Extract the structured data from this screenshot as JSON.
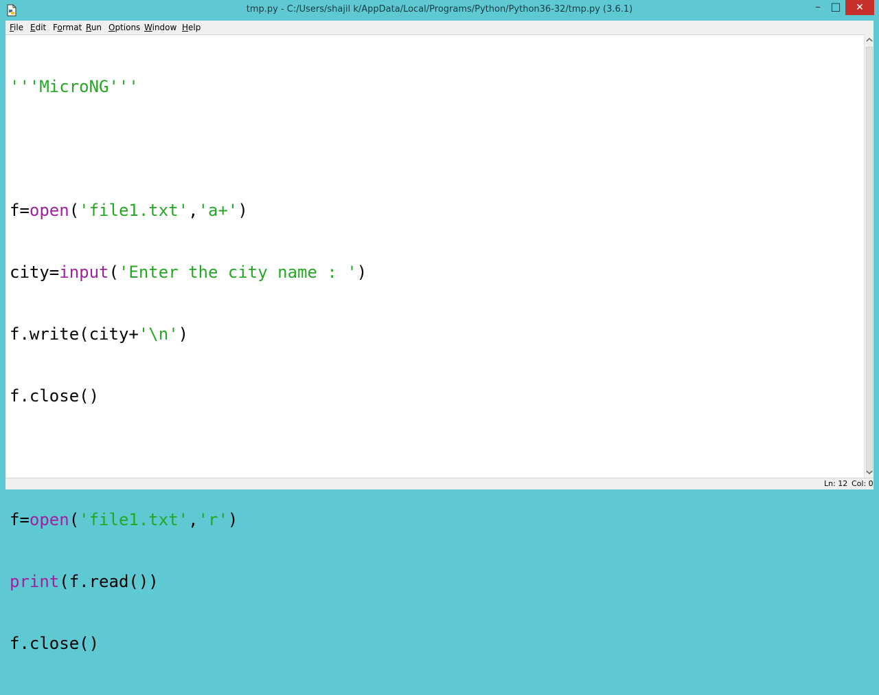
{
  "window": {
    "title": "tmp.py - C:/Users/shajil k/AppData/Local/Programs/Python/Python36-32/tmp.py (3.6.1)",
    "minimize_glyph": "–",
    "maximize_glyph": "□",
    "close_glyph": "✕"
  },
  "menu": {
    "file": {
      "key": "F",
      "rest": "ile"
    },
    "edit": {
      "key": "E",
      "rest": "dit"
    },
    "format": {
      "pre": "F",
      "key": "o",
      "rest": "rmat"
    },
    "run": {
      "key": "R",
      "rest": "un"
    },
    "options": {
      "key": "O",
      "rest": "ptions"
    },
    "window": {
      "key": "W",
      "rest": "indow"
    },
    "help": {
      "key": "H",
      "rest": "elp"
    }
  },
  "code": {
    "line1": {
      "docstring": "'''MicroNG'''"
    },
    "line3": {
      "a": "f=",
      "kw": "open",
      "b": "(",
      "s1": "'file1.txt'",
      "c": ",",
      "s2": "'a+'",
      "d": ")"
    },
    "line4": {
      "a": "city=",
      "kw": "input",
      "b": "(",
      "s1": "'Enter the city name : '",
      "c": ")"
    },
    "line5": {
      "a": "f.write(city+",
      "s1": "'\\n'",
      "b": ")"
    },
    "line6": {
      "a": "f.close()"
    },
    "line8": {
      "a": "f=",
      "kw": "open",
      "b": "(",
      "s1": "'file1.txt'",
      "c": ",",
      "s2": "'r'",
      "d": ")"
    },
    "line9": {
      "kw": "print",
      "a": "(f.read())"
    },
    "line10": {
      "a": "f.close()"
    }
  },
  "status": {
    "line": "Ln: 12",
    "col": "Col: 0"
  },
  "colors": {
    "titlebar": "#5ec9d3",
    "string": "#24a824",
    "builtin": "#a020a0",
    "close_button": "#c7302a"
  },
  "icons": {
    "app": "python-idle-file-icon",
    "minimize": "minimize-icon",
    "maximize": "maximize-icon",
    "close": "close-icon"
  }
}
